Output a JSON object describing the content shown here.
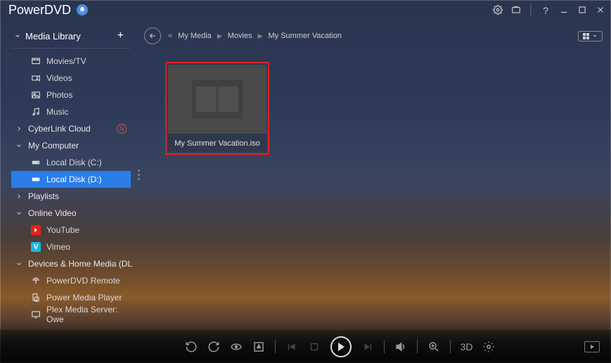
{
  "titlebar": {
    "app_name": "PowerDVD"
  },
  "sidebar": {
    "header": "Media Library",
    "media_library": {
      "movies_tv": "Movies/TV",
      "videos": "Videos",
      "photos": "Photos",
      "music": "Music"
    },
    "cyberlink_cloud": "CyberLink Cloud",
    "badge_n": "N",
    "my_computer": {
      "label": "My Computer",
      "disk_c": "Local Disk (C:)",
      "disk_d": "Local Disk (D:)"
    },
    "playlists": "Playlists",
    "online_video": {
      "label": "Online Video",
      "youtube": "YouTube",
      "vimeo": "Vimeo",
      "vimeo_badge": "V"
    },
    "devices": {
      "label": "Devices & Home Media (DL",
      "powerdvd_remote": "PowerDVD Remote",
      "power_media_player": "Power Media Player",
      "plex": "Plex Media Server: Owe"
    }
  },
  "breadcrumbs": {
    "root": "My Media",
    "level1": "Movies",
    "level2": "My Summer Vacation"
  },
  "content": {
    "file1_label": "My Summer Vacation.iso"
  },
  "playerbar": {
    "threeD": "3D"
  }
}
